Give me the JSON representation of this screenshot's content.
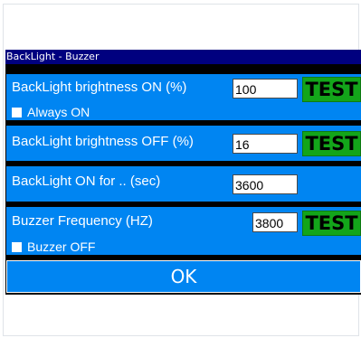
{
  "dialog": {
    "title": "BackLight - Buzzer",
    "brightness_on": {
      "label": "BackLight brightness ON  (%)",
      "value": "100",
      "test_label": "TEST",
      "always_on_label": "Always ON",
      "always_on_checked": false
    },
    "brightness_off": {
      "label": "BackLight brightness OFF (%)",
      "value": "16",
      "test_label": "TEST"
    },
    "on_for": {
      "label": "BackLight ON for .. (sec)",
      "value": "3600"
    },
    "buzzer": {
      "label": "Buzzer Frequency (HZ)",
      "value": "3800",
      "test_label": "TEST",
      "off_label": "Buzzer OFF",
      "off_checked": false
    },
    "ok_label": "OK"
  },
  "colors": {
    "title_bar": "#00007f",
    "panel": "#0085f2",
    "test_button": "#13a51a"
  }
}
